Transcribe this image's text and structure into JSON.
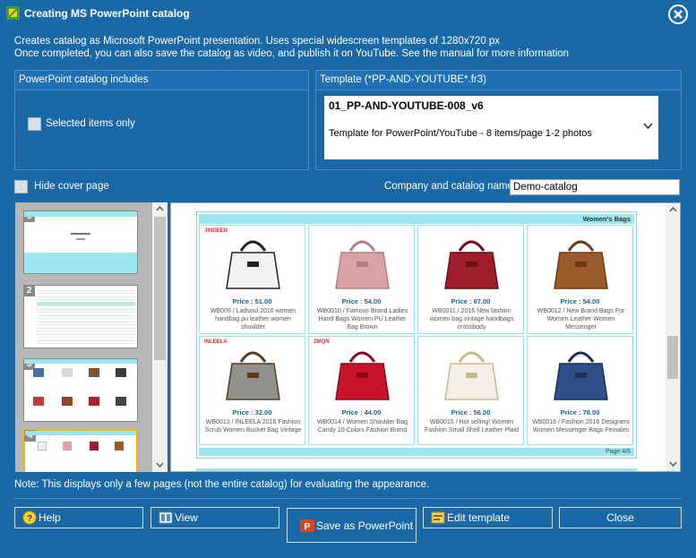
{
  "window": {
    "title": "Creating MS PowerPoint catalog",
    "intro_line1": "Creates catalog as Microsoft PowerPoint presentation. Uses special widescreen templates of 1280x720 px",
    "intro_line2": "Once completed, you can also save the catalog as video, and publish it on YouTube. See the manual for more information"
  },
  "includes_panel": {
    "heading": "PowerPoint catalog includes",
    "selected_only_label": "Selected items only",
    "selected_only_checked": false
  },
  "template_panel": {
    "heading": "Template (*PP-AND-YOUTUBE*.fr3)",
    "selected_name": "01_PP-AND-YOUTUBE-008_v6",
    "selected_description": "Template for PowerPoint/YouTube - 8 items/page 1-2 photos"
  },
  "options": {
    "hide_cover_label": "Hide cover page",
    "hide_cover_checked": false,
    "company_label": "Company and catalog name",
    "company_value": "Demo-catalog"
  },
  "thumbnails": [
    {
      "number": "1"
    },
    {
      "number": "2"
    },
    {
      "number": "3"
    },
    {
      "number": "4",
      "selected": true
    }
  ],
  "preview": {
    "category": "Women's Bags",
    "page_label": "Page 4/6",
    "items": [
      {
        "brand": "JINDEEN",
        "price": "Price  :  51.00",
        "desc": "WB009  /  Ladsoul 2016 women handbag pu leather women shoulder",
        "color": "#f2f2f2",
        "accent": "#222"
      },
      {
        "brand": "",
        "price": "Price  :  54.00",
        "desc": "WB0010  /  Famous Brand Ladies Hand Bags Women PU Leather Bag Brown",
        "color": "#d9a3a6",
        "accent": "#b77b80"
      },
      {
        "brand": "",
        "price": "Price  :  67.00",
        "desc": "WB0011  /  2016 New fashion women bag vintage handbags crossbody",
        "color": "#9e1f2b",
        "accent": "#6d0f18"
      },
      {
        "brand": "",
        "price": "Price  :  54.00",
        "desc": "WB0012  /  New Brand Bags For Women Leather Women Messenger",
        "color": "#9a5a2a",
        "accent": "#6e3a16"
      },
      {
        "brand": "INLEELA",
        "price": "Price  :  32.00",
        "desc": "WB0013  /  INLEELA 2016 Fashion Scrub Women Bucket Bag Vintage",
        "color": "#8f928a",
        "accent": "#5b3a22"
      },
      {
        "brand": "ZMQN",
        "price": "Price  :  44.00",
        "desc": "WB0014  /  Women Shoulder Bag Candy 10 Colors Fashion Brand",
        "color": "#c8142a",
        "accent": "#8c0b1b"
      },
      {
        "brand": "",
        "price": "Price  :  56.00",
        "desc": "WB0015  /  Hot selling! Women Fashion Small Shell Leather Plaid",
        "color": "#f4efe6",
        "accent": "#c8b98a"
      },
      {
        "brand": "",
        "price": "Price  :  78.00",
        "desc": "WB0016  /  Fashion 2016 Designers Women Messenger Bags Females",
        "color": "#2f4f8c",
        "accent": "#1b2f59"
      }
    ]
  },
  "note": "Note: This displays only a few pages (not the entire catalog) for evaluating the appearance.",
  "buttons": {
    "help": "Help",
    "view": "View",
    "save": "Save as PowerPoint",
    "edit": "Edit template",
    "close": "Close"
  }
}
